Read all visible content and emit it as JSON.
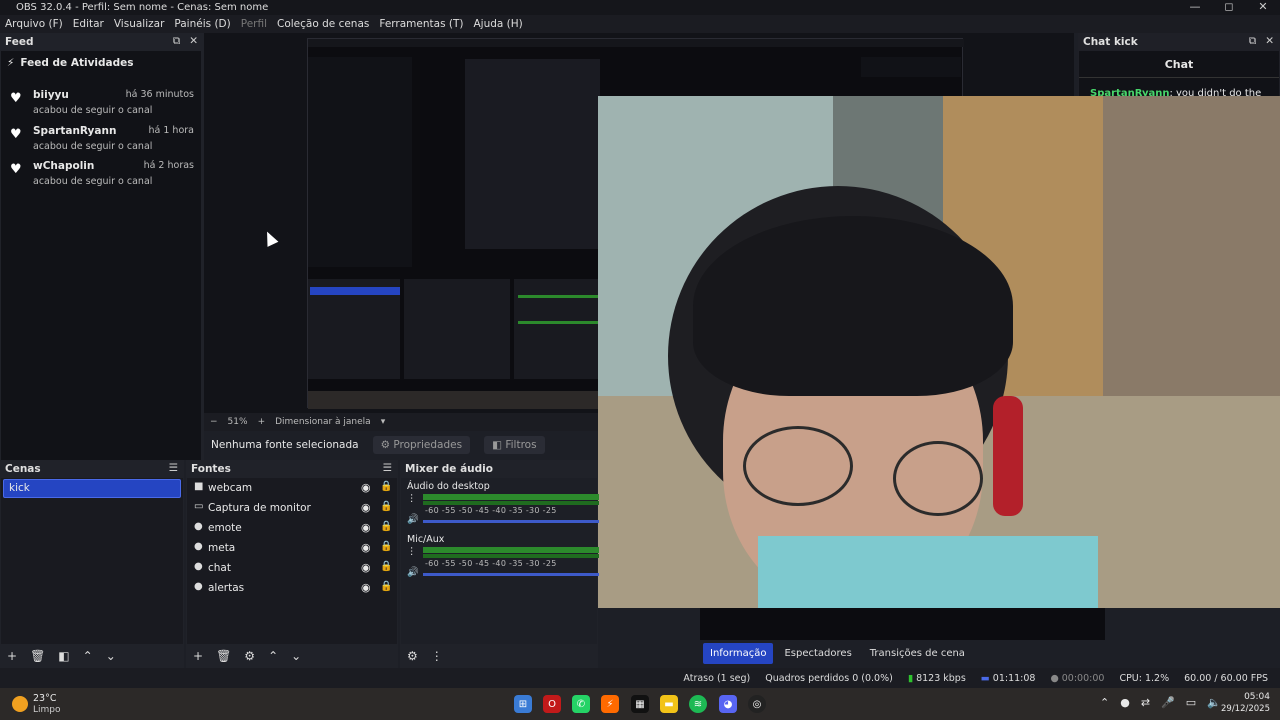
{
  "window": {
    "title": "OBS 32.0.4 - Perfil: Sem nome - Cenas: Sem nome",
    "controls": [
      "—",
      "◻",
      "✕"
    ]
  },
  "menu": [
    {
      "label": "Arquivo (F)",
      "enabled": true
    },
    {
      "label": "Editar",
      "enabled": true
    },
    {
      "label": "Visualizar",
      "enabled": true
    },
    {
      "label": "Painéis (D)",
      "enabled": true
    },
    {
      "label": "Perfil",
      "enabled": false
    },
    {
      "label": "Coleção de cenas",
      "enabled": true
    },
    {
      "label": "Ferramentas (T)",
      "enabled": true
    },
    {
      "label": "Ajuda (H)",
      "enabled": true
    }
  ],
  "feed": {
    "dock_title": "Feed",
    "heading": "Feed de Atividades",
    "items": [
      {
        "name": "biiyyu",
        "time": "há 36 minutos",
        "action": "acabou de seguir o canal"
      },
      {
        "name": "SpartanRyann",
        "time": "há 1 hora",
        "action": "acabou de seguir o canal"
      },
      {
        "name": "wChapolin",
        "time": "há 2 horas",
        "action": "acabou de seguir o canal"
      }
    ]
  },
  "preview": {
    "zoom": "51%",
    "resize_label": "Dimensionar à janela",
    "no_source": "Nenhuma fonte selecionada",
    "properties_label": "Propriedades",
    "filters_label": "Filtros"
  },
  "chat": {
    "dock_title": "Chat kick",
    "title": "Chat",
    "user": "SpartanRyann",
    "text": ": you didn't do the"
  },
  "scenes": {
    "title": "Cenas",
    "items": [
      "kick"
    ]
  },
  "sources": {
    "title": "Fontes",
    "items": [
      {
        "label": "webcam",
        "icon": "camera-icon"
      },
      {
        "label": "Captura de monitor",
        "icon": "monitor-icon"
      },
      {
        "label": "emote",
        "icon": "globe-icon"
      },
      {
        "label": "meta",
        "icon": "globe-icon"
      },
      {
        "label": "chat",
        "icon": "globe-icon"
      },
      {
        "label": "alertas",
        "icon": "globe-icon"
      }
    ]
  },
  "mixer": {
    "title": "Mixer de áudio",
    "tracks": [
      {
        "name": "Áudio do desktop"
      },
      {
        "name": "Mic/Aux"
      }
    ],
    "scale": "-60   -55   -50   -45   -40   -35   -30   -25"
  },
  "tabs": [
    "Informação",
    "Espectadores",
    "Transições de cena"
  ],
  "status": {
    "delay": "Atraso (1 seg)",
    "dropped": "Quadros perdidos 0 (0.0%)",
    "bitrate": "8123 kbps",
    "live_time": "01:11:08",
    "rec_time": "00:00:00",
    "cpu": "CPU: 1.2%",
    "fps": "60.00 / 60.00 FPS"
  },
  "taskbar": {
    "temp": "23°C",
    "weather": "Limpo",
    "time": "05:04",
    "date": "29/12/2025"
  },
  "colors": {
    "accent": "#2545c2",
    "meter": "#2c8a2c",
    "live": "#2ec22e"
  }
}
